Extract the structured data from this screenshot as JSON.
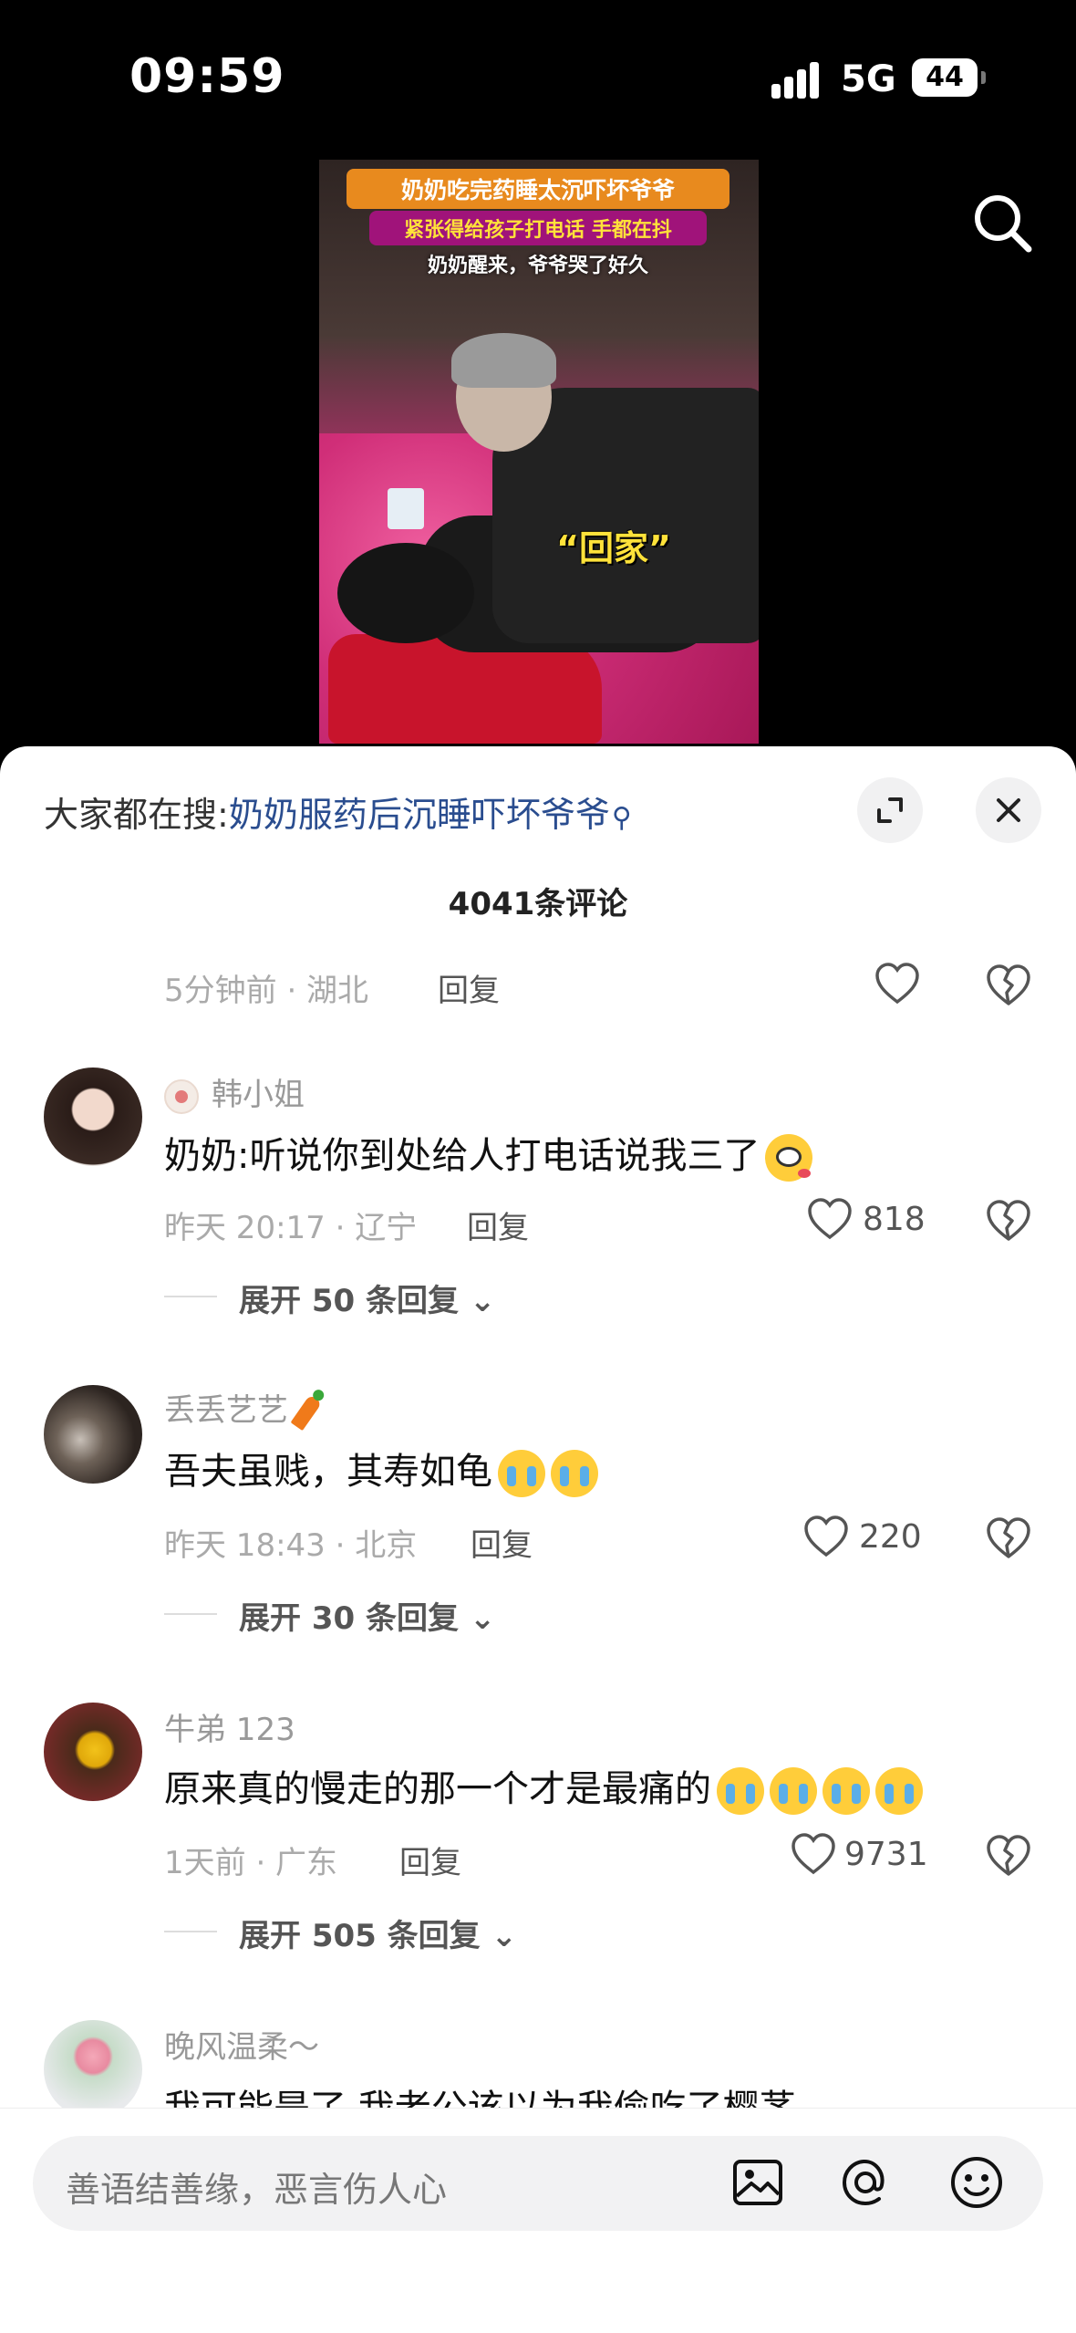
{
  "status_bar": {
    "time": "09:59",
    "network": "5G",
    "battery": "44"
  },
  "video": {
    "caption_line1": "奶奶吃完药睡太沉吓坏爷爷",
    "caption_line2": "紧张得给孩子打电话 手都在抖",
    "caption_line3": "奶奶醒来，爷爷哭了好久",
    "overlay_text": "“回家”"
  },
  "comments_sheet": {
    "search_prefix": "大家都在搜:",
    "search_term": "奶奶服药后沉睡吓坏爷爷",
    "count_label": "4041条评论",
    "reply_label": "回复",
    "top_partial": {
      "meta": "5分钟前 · 湖北"
    },
    "comments": [
      {
        "username": "韩小姐",
        "text": "奶奶:听说你到处给人打电话说我三了",
        "meta": "昨天 20:17 · 辽宁",
        "likes": "818",
        "expand": "展开 50 条回复"
      },
      {
        "username": "丢丢艺艺",
        "text": "吾夫虽贱，其寿如龟",
        "meta": "昨天 18:43 · 北京",
        "likes": "220",
        "expand": "展开 30 条回复"
      },
      {
        "username": "牛弟 123",
        "text": "原来真的慢走的那一个才是最痛的",
        "meta": "1天前 · 广东",
        "likes": "9731",
        "expand": "展开 505 条回复"
      },
      {
        "username": "晚风温柔～",
        "text": "我可能是了 我老公该以为我偷吃了樱茅"
      }
    ]
  },
  "input_bar": {
    "placeholder": "善语结善缘，恶言伤人心"
  },
  "colors": {
    "link": "#2a4d8f",
    "background": "#000000",
    "sheet": "#ffffff"
  },
  "icons": [
    "search-icon",
    "expand-icon",
    "close-icon",
    "heart-icon",
    "broken-heart-icon",
    "chevron-down-icon",
    "image-icon",
    "at-icon",
    "emoji-icon"
  ]
}
